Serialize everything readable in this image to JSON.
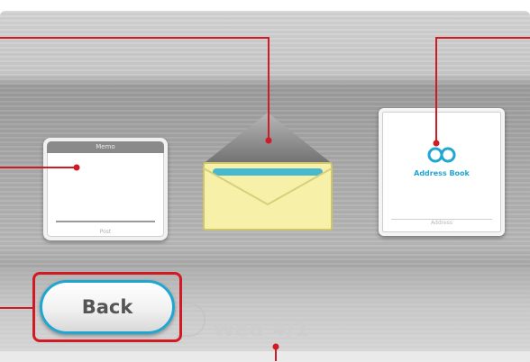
{
  "memo_board": {
    "title": "Memo",
    "footer": "Post"
  },
  "message_envelope": {
    "icon": "envelope-icon"
  },
  "address_book": {
    "label": "Address Book",
    "icon": "address-book-icon",
    "footer": "Address"
  },
  "back_button": {
    "label": "Back"
  },
  "date": {
    "text": "Wed 4/1"
  },
  "colors": {
    "accent": "#1fa6d1",
    "callout": "#d11a24",
    "envelope_body": "#f6f0a8",
    "envelope_flap": "#8f8f8f"
  }
}
